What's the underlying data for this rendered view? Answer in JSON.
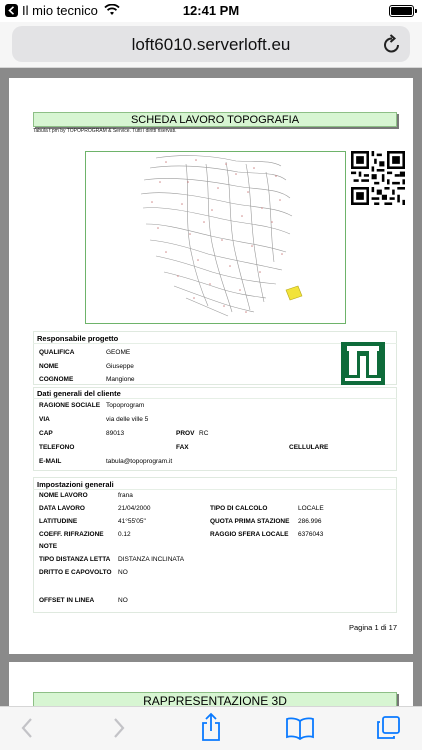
{
  "status": {
    "carrier": "Il mio tecnico",
    "time": "12:41 PM"
  },
  "browser": {
    "url": "loft6010.serverloft.eu"
  },
  "doc": {
    "title": "SCHEDA LAVORO TOPOGRAFIA",
    "copyright": "Tabula t pm by TOPOPROGRAM & Service. Tutti i diritti riservati.",
    "responsabile": {
      "heading": "Responsabile progetto",
      "qualifica_label": "QUALIFICA",
      "qualifica": "GEOME",
      "nome_label": "NOME",
      "nome": "Giuseppe",
      "cognome_label": "COGNOME",
      "cognome": "Mangione"
    },
    "cliente": {
      "heading": "Dati generali del cliente",
      "ragione_label": "RAGIONE SOCIALE",
      "ragione": "Topoprogram",
      "via_label": "VIA",
      "via": "via delle ville 5",
      "cap_label": "CAP",
      "cap": "89013",
      "prov_label": "PROV",
      "prov": "RC",
      "telefono_label": "TELEFONO",
      "fax_label": "FAX",
      "cellulare_label": "CELLULARE",
      "email_label": "E-MAIL",
      "email": "tabula@topoprogram.it"
    },
    "impostazioni": {
      "heading": "Impostazioni generali",
      "nome_lavoro_label": "NOME LAVORO",
      "nome_lavoro": "frana",
      "data_lavoro_label": "DATA LAVORO",
      "data_lavoro": "21/04/2000",
      "tipo_calcolo_label": "TIPO DI CALCOLO",
      "tipo_calcolo": "LOCALE",
      "latitudine_label": "LATITUDINE",
      "latitudine": "41°55'05\"",
      "quota_label": "QUOTA PRIMA STAZIONE",
      "quota": "286.996",
      "coeff_label": "COEFF. RIFRAZIONE",
      "coeff": "0.12",
      "raggio_label": "RAGGIO SFERA LOCALE",
      "raggio": "6376043",
      "note_label": "NOTE",
      "distanza_label": "TIPO DISTANZA LETTA",
      "distanza": "DISTANZA INCLINATA",
      "dritto_label": "DRITTO E CAPOVOLTO",
      "dritto": "NO",
      "offset_label": "OFFSET IN LINEA",
      "offset": "NO"
    },
    "pagination": {
      "pagina_label": "Pagina",
      "current": "1",
      "di_label": "di",
      "total": "17"
    },
    "next_title": "RAPPRESENTAZIONE 3D"
  }
}
